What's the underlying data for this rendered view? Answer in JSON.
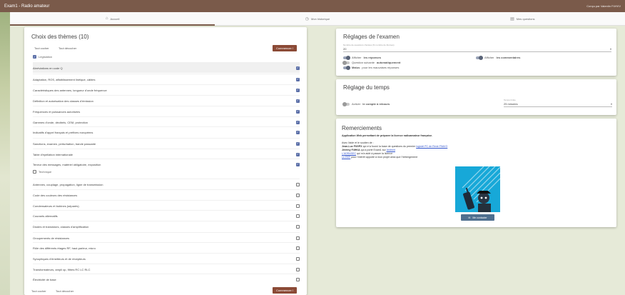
{
  "window": {
    "title": "Exam1 - Radio amateur",
    "credit": "Conçu par Valentin F4HVV"
  },
  "tabs": [
    {
      "label": "Accueil",
      "icon": "home-icon"
    },
    {
      "label": "Mon historique",
      "icon": "history-icon"
    },
    {
      "label": "Mes questions",
      "icon": "questions-icon"
    }
  ],
  "themes": {
    "title": "Choix des thèmes (10)",
    "check_all": "Tout cocher",
    "uncheck_all": "Tout décocher",
    "start": "Commencer !",
    "legislation_label": "Législation",
    "technique_label": "Technique",
    "legislation": [
      "Abréviations en code Q",
      "Adaptation, ROS, affaiblissement linéique, câbles",
      "Caractéristiques des antennes, longueur d'onde fréquence",
      "Définition et autorisation des classes d'émission",
      "Fréquences et puissances autorisées",
      "Gammes d'onde, décibels, CEM, protection",
      "Indicatifs d'appel français et préfixes européens",
      "Sanctions, examen, perturbation, bande passante",
      "Table d'épellation internationale",
      "Teneur des messages, matériel obligatoire, exposition"
    ],
    "technique": [
      "Antennes, couplage, propagation, ligne de transmission",
      "Code des couleurs des résistances",
      "Condensateurs et bobines (séparés)",
      "Courants alternatifs",
      "Diodes et transistors, classes d'amplification",
      "Groupements de résistances",
      "Rôle des différents étages RF, haut-parleur, micro",
      "Synoptiques d'émetteurs et de récepteurs",
      "Transformateurs, ampli op, filtres RC LC RLC",
      "Électricité de base"
    ]
  },
  "exam_settings": {
    "title": "Réglages de l'examen",
    "question_count_caption": "Nombre de questions choisies (% nombre de thèmes)",
    "question_count": "20",
    "show_answers_prefix": "Afficher",
    "show_answers_bold": "les réponses",
    "auto_next_prefix": "Question suivante",
    "auto_next_bold": "automatiquement",
    "penalty_bold": "Malus",
    "penalty_suffix": "pour les mauvaises réponses",
    "show_comments_prefix": "Afficher",
    "show_comments_bold": "les commentaires"
  },
  "time_settings": {
    "title": "Réglage du temps",
    "countdown_prefix": "Activer",
    "countdown_bold": "le compte à rebours",
    "time_caption": "Temps limite",
    "time_value": "25 minutes"
  },
  "thanks": {
    "title": "Remerciements",
    "subtitle": "Application Web permettant de préparer la licence radioamateur française.",
    "intro": "Avec l'aide et le soutien de :",
    "line1_name": "Jean-Luc F6GPX",
    "line1_text": "qui m'a fourni la base de questions du premier",
    "line1_link": "logiciel PC de René F5AVG",
    "line2_name": "Jérémy F4HKA",
    "line2_text": "qui a porté Exam1 sur",
    "line2_link": "Android",
    "line3_link": "L'ADRASEC",
    "line3_text": "qui m'a aidé à passer la licence",
    "line4_link": "Le REF",
    "line4_text": "pour l'intérêt apporté à mon projet ainsi que l'hébergement",
    "contact": "Me contacter"
  },
  "colors": {
    "accent": "#8b4a36",
    "titlebar": "#7a5a4a",
    "checkbox": "#5b6fa8",
    "illustration": "#17a8d8"
  }
}
